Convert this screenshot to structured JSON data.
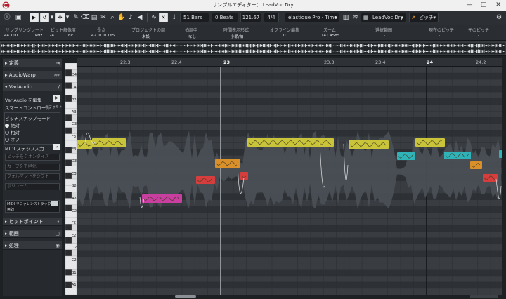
{
  "window": {
    "title": "サンプルエディター： LeadVoc Dry"
  },
  "toolbar": {
    "length": "51 Bars",
    "offset": "0 Beats",
    "tempo": "121.67",
    "signature": "4/4",
    "algorithm": "élastique Pro - Time",
    "track": "LeadVoc Dry",
    "pitch": "ピッチ"
  },
  "infoline": {
    "columns": [
      {
        "label": "サンプリングレート",
        "value": "44.100"
      },
      {
        "label": "ビット解像度",
        "value": "24"
      },
      {
        "label": "長さ",
        "value": "42. 0. 0.165"
      },
      {
        "label": "プロジェクトの調",
        "value": "未設"
      },
      {
        "label": "拍調中",
        "value": "なし"
      },
      {
        "label": "時間表示形式",
        "value": "小節/拍"
      },
      {
        "label": "オフライン編集",
        "value": "0"
      },
      {
        "label": "ズーム",
        "value": "141.4585"
      },
      {
        "label": "選択範囲",
        "value": "-"
      },
      {
        "label": "現在のピッチ",
        "value": "-"
      },
      {
        "label": "元のピッチ",
        "value": "-"
      }
    ],
    "units": [
      "kHz",
      "bit"
    ]
  },
  "inspector": {
    "sections": {
      "definition": "定義",
      "audiowarp": "AudioWarp",
      "variaudio": "VariAudio",
      "hitpoint": "ヒットポイント",
      "range": "範囲",
      "process": "処理"
    },
    "variaudio_edit": "VariAudio を編集",
    "smart_control": "スマートコントロール",
    "smart_default": "デフォルト",
    "pitch_snap_mode": "ピッチスナップモード",
    "snap_options": [
      "絶対",
      "相対",
      "オフ"
    ],
    "midi_step": "MIDI ステップ入力",
    "disabled_items": [
      "ピッチをクオンタイズ",
      "カーブを平坦化",
      "フォルマントをシフト",
      "ボリューム"
    ],
    "midi_select": "MIDI リファレンストラック",
    "midi_select_sub": "無効"
  },
  "ruler": {
    "ticks": [
      "22.3",
      "22.4",
      "23",
      "23.3",
      "23.4",
      "24",
      "24.2"
    ]
  },
  "keyboard": {
    "labels": [
      "D4",
      "C4",
      "B3",
      "A3",
      "G3",
      "F3",
      "E3",
      "D3",
      "C3",
      "B2",
      "A2",
      "G2",
      "F2",
      "E2",
      "D2",
      "C2",
      "B1",
      "A1"
    ]
  },
  "segment_colors": {
    "yellow": "#c9c43a",
    "magenta": "#c83f9f",
    "red": "#d63d3d",
    "orange": "#d98f2a",
    "cyan": "#2fb3b8"
  }
}
